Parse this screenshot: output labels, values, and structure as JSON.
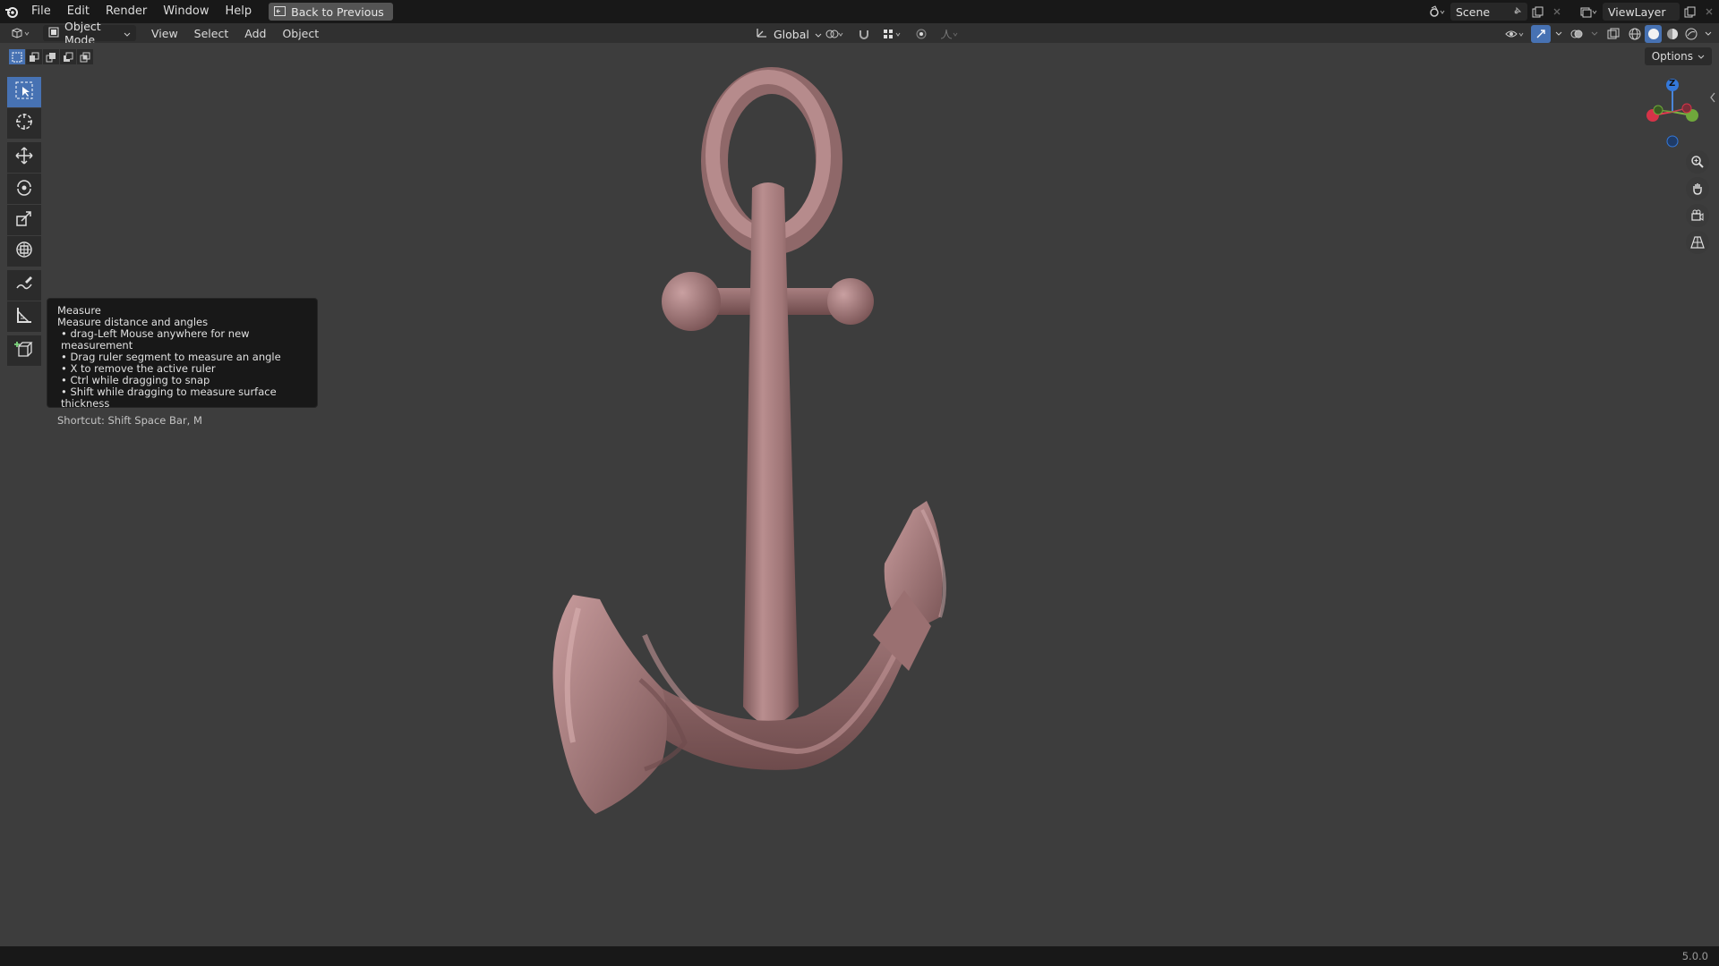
{
  "menubar": {
    "items": [
      "File",
      "Edit",
      "Render",
      "Window",
      "Help"
    ],
    "back_button": "Back to Previous",
    "scene_name": "Scene",
    "view_layer": "ViewLayer"
  },
  "header": {
    "mode": "Object Mode",
    "menus": [
      "View",
      "Select",
      "Add",
      "Object"
    ],
    "transform_orientation": "Global"
  },
  "viewport": {
    "options_label": "Options"
  },
  "gizmo": {
    "z_label": "Z"
  },
  "tooltip": {
    "title": "Measure",
    "description": "Measure distance and angles",
    "bullets": [
      "• drag-Left Mouse anywhere for new measurement",
      "• Drag ruler segment to measure an angle",
      "• X to remove the active ruler",
      "• Ctrl while dragging to snap",
      "• Shift while dragging to measure surface thickness"
    ],
    "shortcut": "Shortcut: Shift Space Bar, M"
  },
  "statusbar": {
    "version": "5.0.0"
  },
  "colors": {
    "accent": "#4772b3",
    "object": "#a87b7c"
  }
}
